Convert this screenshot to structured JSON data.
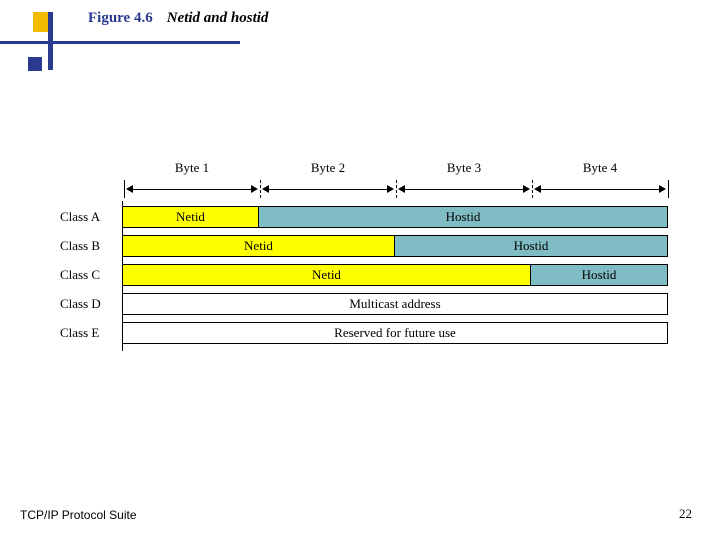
{
  "header": {
    "figure_label": "Figure 4.6",
    "figure_title": "Netid and hostid"
  },
  "bytes": [
    "Byte 1",
    "Byte 2",
    "Byte 3",
    "Byte 4"
  ],
  "rows": [
    {
      "label": "Class A",
      "segments": [
        {
          "text": "Netid",
          "kind": "netid",
          "span": 1
        },
        {
          "text": "Hostid",
          "kind": "hostid",
          "span": 3
        }
      ]
    },
    {
      "label": "Class B",
      "segments": [
        {
          "text": "Netid",
          "kind": "netid",
          "span": 2
        },
        {
          "text": "Hostid",
          "kind": "hostid",
          "span": 2
        }
      ]
    },
    {
      "label": "Class C",
      "segments": [
        {
          "text": "Netid",
          "kind": "netid",
          "span": 3
        },
        {
          "text": "Hostid",
          "kind": "hostid",
          "span": 1
        }
      ]
    },
    {
      "label": "Class D",
      "segments": [
        {
          "text": "Multicast address",
          "kind": "plain",
          "span": 4
        }
      ]
    },
    {
      "label": "Class E",
      "segments": [
        {
          "text": "Reserved for future use",
          "kind": "plain",
          "span": 4
        }
      ]
    }
  ],
  "footer": {
    "left": "TCP/IP Protocol Suite",
    "page": "22"
  },
  "colors": {
    "netid": "#ffff00",
    "hostid": "#7fbcc4",
    "accent": "#2a3b8f",
    "gold": "#f2bb00"
  }
}
